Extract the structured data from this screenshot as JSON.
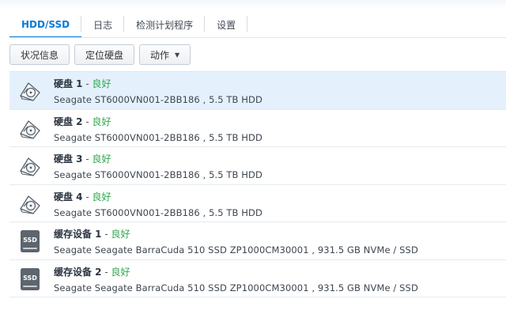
{
  "tabs": [
    {
      "label": "HDD/SSD",
      "active": true
    },
    {
      "label": "日志",
      "active": false
    },
    {
      "label": "检测计划程序",
      "active": false
    },
    {
      "label": "设置",
      "active": false
    }
  ],
  "toolbar": {
    "status_info": "状况信息",
    "locate_drive": "定位硬盘",
    "action": "动作"
  },
  "colors": {
    "accent": "#0b7bd3",
    "status_good": "#2ea84f",
    "selected_row": "#e4f1fc"
  },
  "drives": [
    {
      "name": "硬盘 1",
      "dash": " - ",
      "status": "良好",
      "desc": "Seagate ST6000VN001-2BB186 , 5.5 TB HDD",
      "icon": "hdd-icon"
    },
    {
      "name": "硬盘 2",
      "dash": " - ",
      "status": "良好",
      "desc": "Seagate ST6000VN001-2BB186 , 5.5 TB HDD",
      "icon": "hdd-icon"
    },
    {
      "name": "硬盘 3",
      "dash": " - ",
      "status": "良好",
      "desc": "Seagate ST6000VN001-2BB186 , 5.5 TB HDD",
      "icon": "hdd-icon"
    },
    {
      "name": "硬盘 4",
      "dash": " - ",
      "status": "良好",
      "desc": "Seagate ST6000VN001-2BB186 , 5.5 TB HDD",
      "icon": "hdd-icon"
    },
    {
      "name": "缓存设备 1",
      "dash": " - ",
      "status": "良好",
      "desc": "Seagate Seagate BarraCuda 510 SSD ZP1000CM30001 , 931.5 GB NVMe / SSD",
      "icon": "ssd-icon",
      "icon_label": "SSD"
    },
    {
      "name": "缓存设备 2",
      "dash": " - ",
      "status": "良好",
      "desc": "Seagate Seagate BarraCuda 510 SSD ZP1000CM30001 , 931.5 GB NVMe / SSD",
      "icon": "ssd-icon",
      "icon_label": "SSD"
    }
  ]
}
